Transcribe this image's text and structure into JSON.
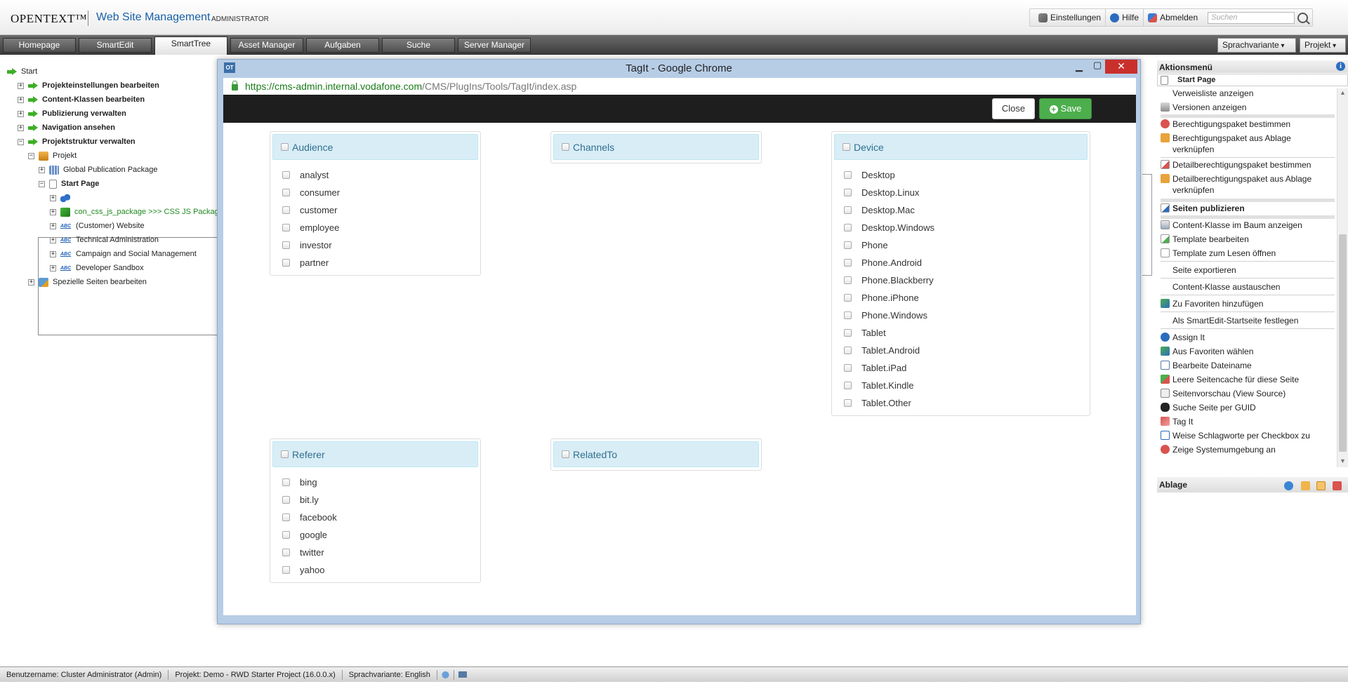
{
  "header": {
    "brand": "OPENTEXT™",
    "product": "Web Site Management",
    "role": "ADMINISTRATOR",
    "links": [
      {
        "label": "Einstellungen",
        "icon": "tools-icon"
      },
      {
        "label": "Hilfe",
        "icon": "help-icon"
      },
      {
        "label": "Abmelden",
        "icon": "logout-icon"
      }
    ],
    "search_placeholder": "Suchen"
  },
  "nav": {
    "tabs": [
      "Homepage",
      "SmartEdit",
      "SmartTree",
      "Asset Manager",
      "Aufgaben",
      "Suche",
      "Server Manager"
    ],
    "active_tab": "SmartTree",
    "dropdowns": [
      "Sprachvariante",
      "Projekt"
    ]
  },
  "tree": {
    "start": "Start",
    "items": [
      "Projekteinstellungen bearbeiten",
      "Content-Klassen bearbeiten",
      "Publizierung verwalten",
      "Navigation ansehen",
      "Projektstruktur verwalten"
    ],
    "project": "Projekt",
    "global_package": "Global Publication Package",
    "start_page": "Start Page",
    "css_package": "con_css_js_package >>> CSS JS Package",
    "children": [
      "(Customer) Website",
      "Technical Administration",
      "Campaign and Social Management",
      "Developer Sandbox"
    ],
    "special": "Spezielle Seiten bearbeiten"
  },
  "action_menu": {
    "title": "Aktionsmenü",
    "page": "Start Page",
    "items": [
      "Verweisliste anzeigen",
      "Versionen anzeigen",
      "Berechtigungspaket bestimmen",
      "Berechtigungspaket aus Ablage verknüpfen",
      "Detailberechtigungspaket bestimmen",
      "Detailberechtigungspaket aus Ablage verknüpfen",
      "Seiten publizieren",
      "Content-Klasse im Baum anzeigen",
      "Template bearbeiten",
      "Template zum Lesen öffnen",
      "Seite exportieren",
      "Content-Klasse austauschen",
      "Zu Favoriten hinzufügen",
      "Als SmartEdit-Startseite festlegen",
      "Assign It",
      "Aus Favoriten wählen",
      "Bearbeite Dateiname",
      "Leere Seitencache für diese Seite",
      "Seitenvorschau (View Source)",
      "Suche Seite per GUID",
      "Tag It",
      "Weise Schlagworte per Checkbox zu",
      "Zeige Systemumgebung an"
    ],
    "ablage": "Ablage"
  },
  "status": {
    "user": "Benutzername: Cluster Administrator (Admin)",
    "project": "Projekt: Demo - RWD Starter Project (16.0.0.x)",
    "language": "Sprachvariante: English"
  },
  "dialog": {
    "window_title": "TagIt - Google Chrome",
    "ot_badge": "OT",
    "url_host": "https://cms-admin.internal.vodafone.com",
    "url_path": "/CMS/PlugIns/Tools/TagIt/index.asp",
    "close_btn": "Close",
    "save_btn": "Save",
    "panels": {
      "audience": {
        "title": "Audience",
        "options": [
          "analyst",
          "consumer",
          "customer",
          "employee",
          "investor",
          "partner"
        ]
      },
      "channels": {
        "title": "Channels",
        "options": []
      },
      "device": {
        "title": "Device",
        "options": [
          "Desktop",
          "Desktop.Linux",
          "Desktop.Mac",
          "Desktop.Windows",
          "Phone",
          "Phone.Android",
          "Phone.Blackberry",
          "Phone.iPhone",
          "Phone.Windows",
          "Tablet",
          "Tablet.Android",
          "Tablet.iPad",
          "Tablet.Kindle",
          "Tablet.Other"
        ]
      },
      "referer": {
        "title": "Referer",
        "options": [
          "bing",
          "bit.ly",
          "facebook",
          "google",
          "twitter",
          "yahoo"
        ]
      },
      "relatedto": {
        "title": "RelatedTo",
        "options": []
      }
    }
  },
  "colors": {
    "brand_blue": "#1a61a9",
    "tree_arrow": "#3fae28",
    "save_green": "#4cae4c",
    "panel_header_bg": "#d9edf7",
    "panel_header_text": "#31708f",
    "chrome_close_red": "#c9302c",
    "dialog_frame": "#b7cde6"
  }
}
